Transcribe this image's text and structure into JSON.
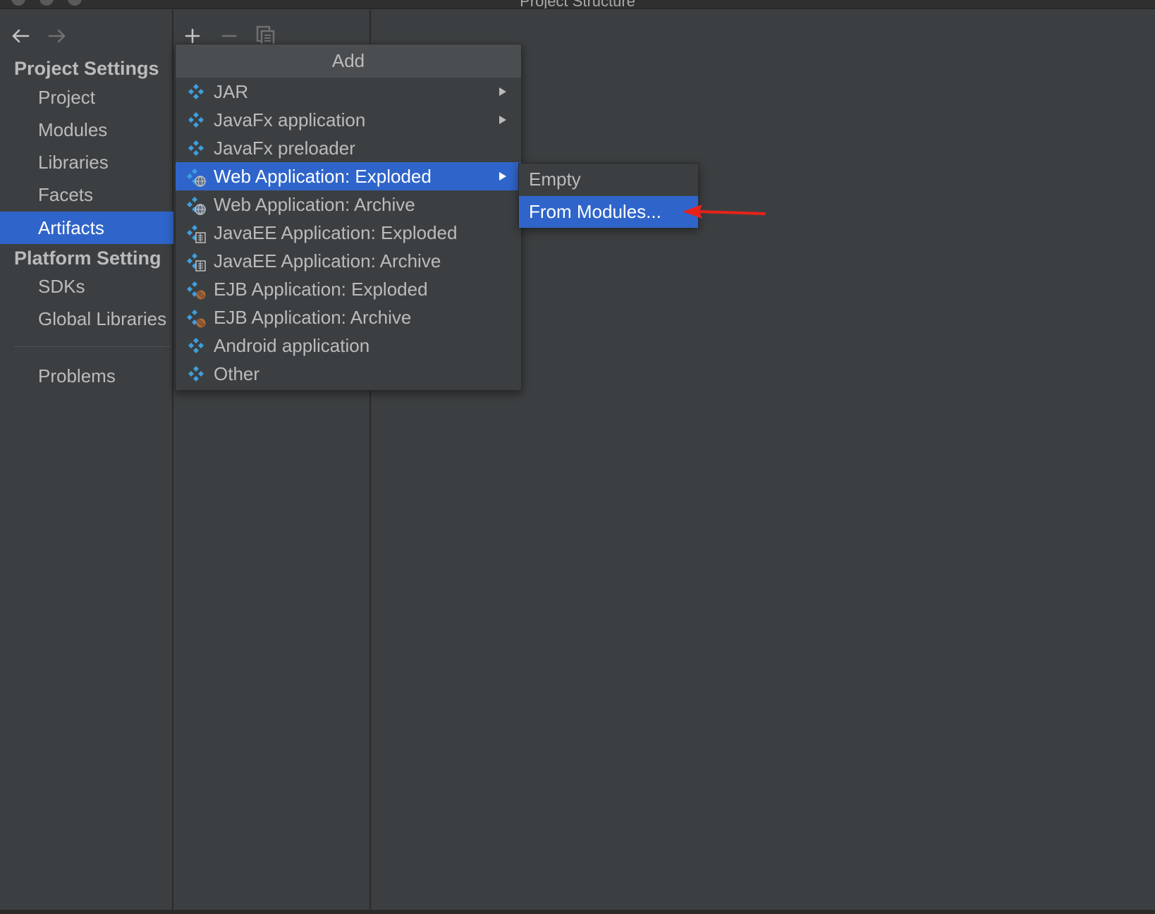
{
  "window": {
    "title": "Project Structure"
  },
  "sidebar": {
    "project_settings_header": "Project Settings",
    "project_items": [
      {
        "label": "Project"
      },
      {
        "label": "Modules"
      },
      {
        "label": "Libraries"
      },
      {
        "label": "Facets"
      },
      {
        "label": "Artifacts",
        "selected": true
      }
    ],
    "platform_settings_header": "Platform Setting",
    "platform_items": [
      {
        "label": "SDKs"
      },
      {
        "label": "Global Libraries"
      }
    ],
    "problems_label": "Problems"
  },
  "toolbar": {
    "icons": [
      "back-arrow-icon",
      "forward-arrow-icon",
      "add-icon",
      "remove-icon",
      "copy-icon"
    ]
  },
  "add_menu": {
    "title": "Add",
    "items": [
      {
        "label": "JAR",
        "icon": "artifact-icon",
        "has_submenu": true
      },
      {
        "label": "JavaFx application",
        "icon": "artifact-icon",
        "has_submenu": true
      },
      {
        "label": "JavaFx preloader",
        "icon": "artifact-icon",
        "has_submenu": false
      },
      {
        "label": "Web Application: Exploded",
        "icon": "web-artifact-icon",
        "has_submenu": true,
        "selected": true
      },
      {
        "label": "Web Application: Archive",
        "icon": "web-artifact-icon",
        "has_submenu": false
      },
      {
        "label": "JavaEE Application: Exploded",
        "icon": "javaee-artifact-icon",
        "has_submenu": false
      },
      {
        "label": "JavaEE Application: Archive",
        "icon": "javaee-artifact-icon",
        "has_submenu": false
      },
      {
        "label": "EJB Application: Exploded",
        "icon": "ejb-artifact-icon",
        "has_submenu": false
      },
      {
        "label": "EJB Application: Archive",
        "icon": "ejb-artifact-icon",
        "has_submenu": false
      },
      {
        "label": "Android application",
        "icon": "artifact-icon",
        "has_submenu": false
      },
      {
        "label": "Other",
        "icon": "artifact-icon",
        "has_submenu": false
      }
    ]
  },
  "submenu": {
    "items": [
      {
        "label": "Empty"
      },
      {
        "label": "From Modules...",
        "selected": true
      }
    ]
  },
  "colors": {
    "background": "#3c3f41",
    "selection": "#2f65ca",
    "text": "#bbbbbb",
    "annotation_arrow": "#e8221b"
  }
}
